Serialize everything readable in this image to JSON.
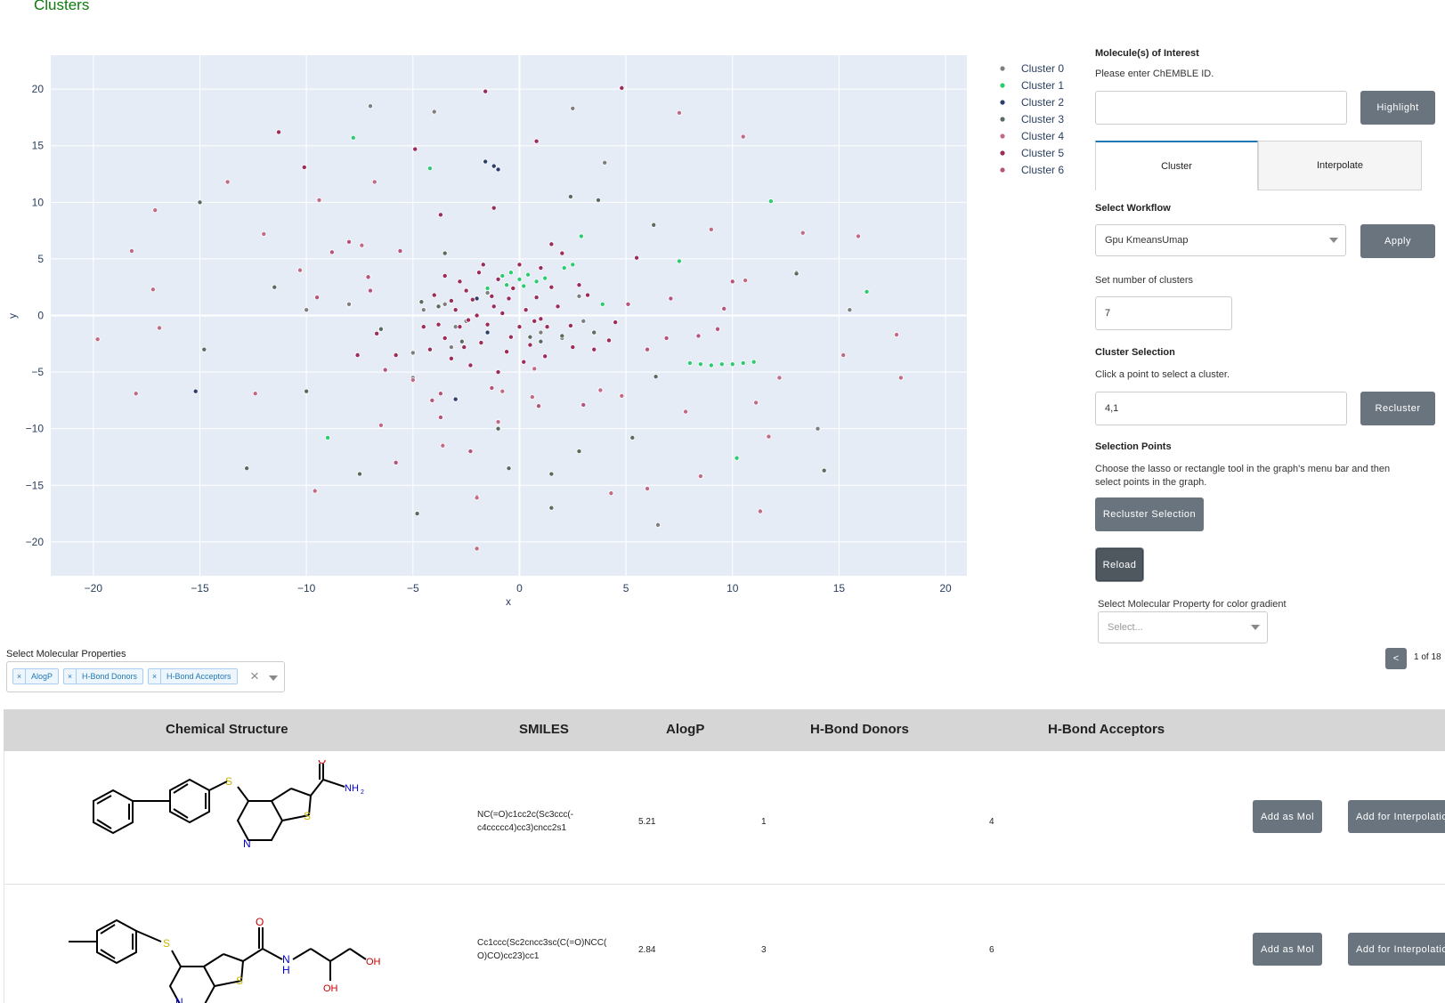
{
  "page": {
    "title": "Clusters"
  },
  "chart_data": {
    "type": "scatter",
    "xlabel": "x",
    "ylabel": "y",
    "xlim": [
      -22,
      21
    ],
    "ylim": [
      -23,
      23
    ],
    "xticks": [
      -20,
      -15,
      -10,
      -5,
      0,
      5,
      10,
      15,
      20
    ],
    "yticks": [
      -20,
      -15,
      -10,
      -5,
      0,
      5,
      10,
      15,
      20
    ],
    "tick_labels_x": [
      "−20",
      "−15",
      "−10",
      "−5",
      "0",
      "5",
      "10",
      "15",
      "20"
    ],
    "tick_labels_y": [
      "−20",
      "−15",
      "−10",
      "−5",
      "0",
      "5",
      "10",
      "15",
      "20"
    ],
    "grid": true,
    "legend_placement": "right",
    "series": [
      {
        "name": "Cluster 0",
        "color": "#7f7f7f",
        "points": [
          [
            -15,
            10
          ],
          [
            -4,
            18
          ],
          [
            4,
            13.5
          ],
          [
            -10,
            0.5
          ],
          [
            -8,
            1
          ],
          [
            -3,
            -1
          ],
          [
            -5,
            -5.5
          ],
          [
            13,
            3.8
          ],
          [
            14,
            -10
          ],
          [
            -7,
            18.5
          ],
          [
            2.5,
            18.3
          ],
          [
            6.5,
            -18.5
          ],
          [
            15.5,
            0.5
          ],
          [
            -2,
            -16
          ],
          [
            -1.5,
            2
          ],
          [
            -3.5,
            1
          ],
          [
            -4.5,
            0.5
          ],
          [
            -2.5,
            -0.5
          ],
          [
            1,
            -1.5
          ],
          [
            2,
            -2
          ],
          [
            3,
            -0.5
          ],
          [
            2.8,
            1.7
          ],
          [
            -5,
            -3.3
          ],
          [
            -3.2,
            -2.8
          ]
        ]
      },
      {
        "name": "Cluster 1",
        "color": "#2ecc71",
        "points": [
          [
            -7.8,
            15.7
          ],
          [
            -4.2,
            13
          ],
          [
            11.8,
            10.1
          ],
          [
            2.9,
            7
          ],
          [
            16.3,
            2.1
          ],
          [
            -9,
            -10.8
          ],
          [
            10.2,
            -12.6
          ],
          [
            3.9,
            1
          ],
          [
            8,
            -4.2
          ],
          [
            8.5,
            -4.3
          ],
          [
            9,
            -4.4
          ],
          [
            9.5,
            -4.3
          ],
          [
            10,
            -4.3
          ],
          [
            10.5,
            -4.2
          ],
          [
            11,
            -4.1
          ],
          [
            -0.8,
            3.5
          ],
          [
            -0.4,
            3.8
          ],
          [
            0,
            3.2
          ],
          [
            0.4,
            3.6
          ],
          [
            0.8,
            3
          ],
          [
            -0.6,
            2.7
          ],
          [
            0.2,
            2.6
          ],
          [
            1.2,
            3.3
          ],
          [
            -1.5,
            2.4
          ],
          [
            2.1,
            4.2
          ],
          [
            2.5,
            4.5
          ],
          [
            7.5,
            4.8
          ]
        ]
      },
      {
        "name": "Cluster 2",
        "color": "#2c3e6e",
        "points": [
          [
            -1.6,
            13.6
          ],
          [
            -1.2,
            13.2
          ],
          [
            -1,
            12.9
          ],
          [
            -15.2,
            -6.7
          ],
          [
            -3,
            -7.4
          ],
          [
            -2,
            1.5
          ],
          [
            -1.5,
            -1.5
          ]
        ]
      },
      {
        "name": "Cluster 3",
        "color": "#5a6b60",
        "points": [
          [
            -15,
            10
          ],
          [
            -3.5,
            5.5
          ],
          [
            6.3,
            8
          ],
          [
            -12.8,
            -13.5
          ],
          [
            14.3,
            -13.7
          ],
          [
            -4.8,
            -17.5
          ],
          [
            -7.5,
            -14
          ],
          [
            -10,
            -6.7
          ],
          [
            1.5,
            -14
          ],
          [
            2.8,
            -12
          ],
          [
            -0.5,
            -13.5
          ],
          [
            5.3,
            -10.8
          ],
          [
            -14.8,
            -3
          ],
          [
            3.5,
            -1.5
          ],
          [
            2,
            -1.8
          ],
          [
            1,
            -2.3
          ],
          [
            0.5,
            -1.9
          ],
          [
            -3.8,
            0.8
          ],
          [
            -4.6,
            1.2
          ],
          [
            -2.7,
            -2.3
          ],
          [
            2.4,
            10.5
          ],
          [
            3.7,
            10.2
          ],
          [
            13,
            3.7
          ],
          [
            -6.5,
            -1.2
          ],
          [
            -11.5,
            2.5
          ],
          [
            1.5,
            -17
          ],
          [
            6.4,
            -5.4
          ],
          [
            -1,
            -10
          ]
        ]
      },
      {
        "name": "Cluster 4",
        "color": "#c06c84",
        "points": [
          [
            7.5,
            17.9
          ],
          [
            10.5,
            15.8
          ],
          [
            -6.8,
            11.8
          ],
          [
            -9.4,
            10.2
          ],
          [
            -13.7,
            11.8
          ],
          [
            -17.1,
            9.3
          ],
          [
            -12,
            7.2
          ],
          [
            -7.4,
            6.2
          ],
          [
            -18.2,
            5.7
          ],
          [
            -17.2,
            2.3
          ],
          [
            -10.3,
            4
          ],
          [
            -19.8,
            -2.1
          ],
          [
            -18,
            -6.9
          ],
          [
            -16.9,
            -1.1
          ],
          [
            -12.4,
            -6.9
          ],
          [
            -6.5,
            -9.7
          ],
          [
            -5,
            -5.7
          ],
          [
            -3.6,
            -11.5
          ],
          [
            -2,
            -16.1
          ],
          [
            -2,
            -20.6
          ],
          [
            -9.6,
            -15.5
          ],
          [
            4.3,
            -15.7
          ],
          [
            8.5,
            -14.2
          ],
          [
            11.3,
            -17.3
          ],
          [
            6,
            -15.3
          ],
          [
            12.2,
            -5.5
          ],
          [
            17.9,
            -5.5
          ],
          [
            17.7,
            -1.7
          ],
          [
            15.2,
            -3.5
          ],
          [
            15.9,
            7
          ],
          [
            13.3,
            7.3
          ],
          [
            9,
            7.6
          ],
          [
            10.6,
            3.1
          ],
          [
            11.1,
            -7.7
          ],
          [
            11.7,
            -10.7
          ],
          [
            7.8,
            -8.5
          ],
          [
            4.8,
            -7.1
          ],
          [
            3.8,
            -6.6
          ],
          [
            0.6,
            -7.2
          ],
          [
            -0.8,
            -6.7
          ],
          [
            -1,
            -9.4
          ],
          [
            0.7,
            -4.7
          ]
        ]
      },
      {
        "name": "Cluster 5",
        "color": "#9b2d5a",
        "points": [
          [
            -1.6,
            19.8
          ],
          [
            4.8,
            20.1
          ],
          [
            -11.3,
            16.2
          ],
          [
            -4.9,
            14.7
          ],
          [
            0.8,
            15.4
          ],
          [
            -10.1,
            13.1
          ],
          [
            -3.7,
            8.9
          ],
          [
            -1.2,
            9.5
          ],
          [
            5.5,
            5.1
          ],
          [
            4.5,
            -0.6
          ],
          [
            -6.7,
            -1.6
          ],
          [
            -7.6,
            -3.5
          ],
          [
            -5.8,
            -3.5
          ],
          [
            -4.2,
            -3
          ],
          [
            -3.5,
            -2
          ],
          [
            -2.8,
            -1
          ],
          [
            -2,
            0
          ],
          [
            -1.2,
            0.8
          ],
          [
            -0.5,
            1.5
          ],
          [
            0.3,
            0.5
          ],
          [
            1,
            -0.3
          ],
          [
            1.8,
            0.8
          ],
          [
            2.4,
            -0.9
          ],
          [
            -2.5,
            2.2
          ],
          [
            -1.8,
            -2.4
          ],
          [
            -0.6,
            -3.2
          ],
          [
            0.5,
            -2.6
          ],
          [
            -3,
            0.5
          ],
          [
            -2.2,
            1.4
          ],
          [
            -1.5,
            -0.8
          ],
          [
            -0.8,
            0.2
          ],
          [
            0,
            -1
          ],
          [
            0.8,
            1.6
          ],
          [
            1.5,
            2.5
          ],
          [
            -3.5,
            3.5
          ],
          [
            -2.8,
            3
          ],
          [
            -1.9,
            3.8
          ],
          [
            -1,
            3.2
          ],
          [
            0,
            4.5
          ],
          [
            1,
            4.2
          ],
          [
            2,
            5.5
          ],
          [
            1.5,
            6.3
          ],
          [
            -4,
            1.8
          ],
          [
            -4.5,
            -1
          ],
          [
            -3.2,
            -3.8
          ],
          [
            -2.3,
            -4.4
          ],
          [
            -1,
            -5
          ],
          [
            0.2,
            -4.1
          ],
          [
            1.2,
            -3.6
          ],
          [
            2.5,
            -2.8
          ],
          [
            3.5,
            -3
          ],
          [
            4.2,
            -2.2
          ],
          [
            3.2,
            1.8
          ],
          [
            2.8,
            2.7
          ],
          [
            -0.3,
            2.4
          ],
          [
            -1.3,
            1.7
          ],
          [
            -2.4,
            -0.4
          ],
          [
            -3.8,
            -0.8
          ],
          [
            -0.4,
            -1.9
          ],
          [
            1.3,
            -1
          ],
          [
            -3.2,
            1.3
          ],
          [
            -1.7,
            4.5
          ],
          [
            -2.6,
            -2.8
          ],
          [
            0.7,
            -0.5
          ]
        ]
      },
      {
        "name": "Cluster 6",
        "color": "#b5557a",
        "points": [
          [
            -9.5,
            1.6
          ],
          [
            -7,
            2.2
          ],
          [
            -8.8,
            5.6
          ],
          [
            -8,
            6.5
          ],
          [
            -6.3,
            -4.8
          ],
          [
            -4.1,
            -7.5
          ],
          [
            -3.7,
            -9
          ],
          [
            -5.8,
            -13
          ],
          [
            -1.3,
            -6.4
          ],
          [
            0.9,
            -8
          ],
          [
            6,
            -3
          ],
          [
            6.9,
            -2
          ],
          [
            7.1,
            1.5
          ],
          [
            9.6,
            0.6
          ],
          [
            9.3,
            -1.2
          ],
          [
            8.4,
            -1.8
          ],
          [
            10,
            3
          ],
          [
            -7.1,
            3.4
          ],
          [
            -5.6,
            5.7
          ],
          [
            -3.7,
            -6.9
          ],
          [
            5.1,
            1
          ],
          [
            -2.3,
            -12
          ],
          [
            3,
            -7.9
          ]
        ]
      }
    ]
  },
  "panel": {
    "moi_title": "Molecule(s) of Interest",
    "moi_hint": "Please enter ChEMBLE ID.",
    "moi_value": "",
    "highlight_label": "Highlight",
    "tabs": [
      {
        "label": "Cluster",
        "active": true
      },
      {
        "label": "Interpolate",
        "active": false
      }
    ],
    "workflow_title": "Select Workflow",
    "workflow_value": "Gpu KmeansUmap",
    "apply_label": "Apply",
    "num_clusters_label": "Set number of clusters",
    "num_clusters_value": "7",
    "cluster_sel_title": "Cluster Selection",
    "cluster_sel_hint": "Click a point to select a cluster.",
    "cluster_sel_value": "4,1",
    "recluster_label": "Recluster",
    "sel_points_title": "Selection Points",
    "sel_points_hint": "Choose the lasso or rectangle tool in the graph's menu bar and then select points in the graph.",
    "recluster_selection_label": "Recluster Selection",
    "reload_label": "Reload",
    "gradient_label": "Select Molecular Property for color gradient",
    "gradient_placeholder": "Select..."
  },
  "props": {
    "label": "Select Molecular Properties",
    "chips": [
      "AlogP",
      "H-Bond Donors",
      "H-Bond Acceptors"
    ],
    "chip_x": "×",
    "clear": "×"
  },
  "pager": {
    "prev": "<",
    "text": "1 of 18"
  },
  "table": {
    "headers": [
      "Chemical Structure",
      "SMILES",
      "AlogP",
      "H-Bond Donors",
      "H-Bond Acceptors"
    ],
    "rows": [
      {
        "smiles_1": "NC(=O)c1cc2c(Sc3ccc(-",
        "smiles_2": "c4ccccc4)cc3)cncc2s1",
        "alogp": "5.21",
        "donors": "1",
        "acceptors": "4",
        "add_mol": "Add as Mol",
        "add_interp": "Add for Interpolation",
        "atoms": {
          "o": "O",
          "nh2": "NH",
          "nh2_sub": "2",
          "s1": "S",
          "s2": "S",
          "n": "N"
        }
      },
      {
        "smiles_1": "Cc1ccc(Sc2cncc3sc(C(=O)NCC(",
        "smiles_2": "O)CO)cc23)cc1",
        "alogp": "2.84",
        "donors": "3",
        "acceptors": "6",
        "add_mol": "Add as Mol",
        "add_interp": "Add for Interpolation",
        "atoms": {
          "o": "O",
          "nh": "N",
          "h": "H",
          "oh1": "OH",
          "oh2": "OH",
          "s1": "S",
          "s2": "S",
          "n": "N"
        }
      }
    ]
  }
}
